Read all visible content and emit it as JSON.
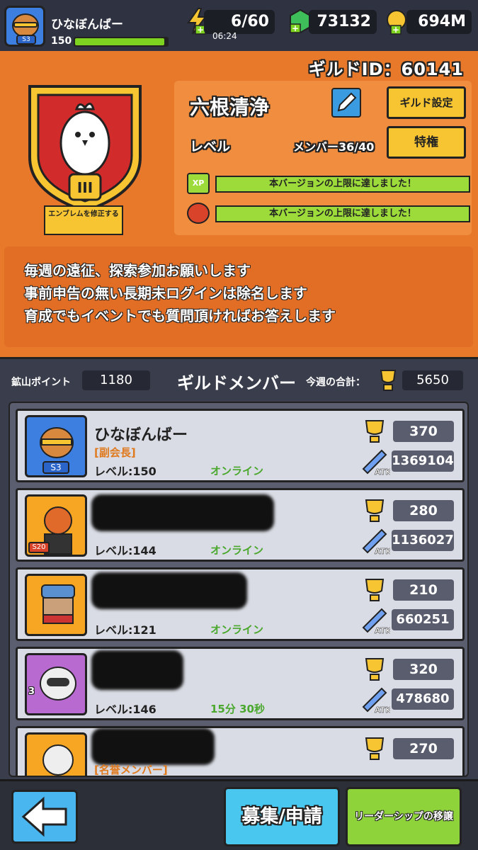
{
  "player": {
    "name": "ひなぼんばー",
    "level": "150",
    "season_badge": "S3",
    "xp_fraction": 0.97
  },
  "resources": {
    "energy": "6/60",
    "energy_timer": "06:24",
    "gems": "73132",
    "gold": "694M"
  },
  "guild": {
    "id_text": "ギルドID：60141",
    "name": "六根清浄",
    "emblem_rank": "III",
    "emblem_edit_label": "エンブレムを修正する",
    "settings_label": "ギルド設定",
    "level_label": "レベル",
    "member_count": "メンバー36/40",
    "perks_label": "特権",
    "xp_icon_label": "XP",
    "limit_xp": "本バージョンの上限に達しました！",
    "limit_craft": "本バージョンの上限に達しました！"
  },
  "notice": {
    "lines": [
      "毎週の遠征、探索参加お願いします",
      "事前申告の無い長期未ログインは除名します",
      "育成でもイベントでも質問頂ければお答えします"
    ]
  },
  "members_header": {
    "mine_label": "鉱山ポイント",
    "mine_value": "1180",
    "title": "ギルドメンバー",
    "weekly_label": "今週の合計：",
    "weekly_value": "5650"
  },
  "members": [
    {
      "name": "ひなぼんばー",
      "role": "[副会長]",
      "level": "レベル:150",
      "status": "オンライン",
      "trophies": "370",
      "atk": "1369104",
      "badge": "S3",
      "atk_label": "ATK"
    },
    {
      "name": "",
      "role": "",
      "level": "レベル:144",
      "status": "オンライン",
      "trophies": "280",
      "atk": "1136027",
      "badge": "S20",
      "atk_label": "ATK"
    },
    {
      "name": "",
      "role": "",
      "level": "レベル:121",
      "status": "オンライン",
      "trophies": "210",
      "atk": "660251",
      "badge": "",
      "atk_label": "ATK"
    },
    {
      "name": "",
      "role": "",
      "level": "レベル:146",
      "status": "15分 30秒",
      "trophies": "320",
      "atk": "478680",
      "badge": "3",
      "atk_label": "ATK"
    },
    {
      "name": "",
      "role": "[名誉メンバー]",
      "level": "",
      "status": "",
      "trophies": "270",
      "atk": "",
      "badge": "",
      "atk_label": ""
    }
  ],
  "bottom": {
    "recruit_label": "募集/申請",
    "transfer_label": "リーダーシップの移譲"
  },
  "colors": {
    "background": "#e8792a",
    "accent_yellow": "#f6c531",
    "online_green": "#4aa82e"
  }
}
